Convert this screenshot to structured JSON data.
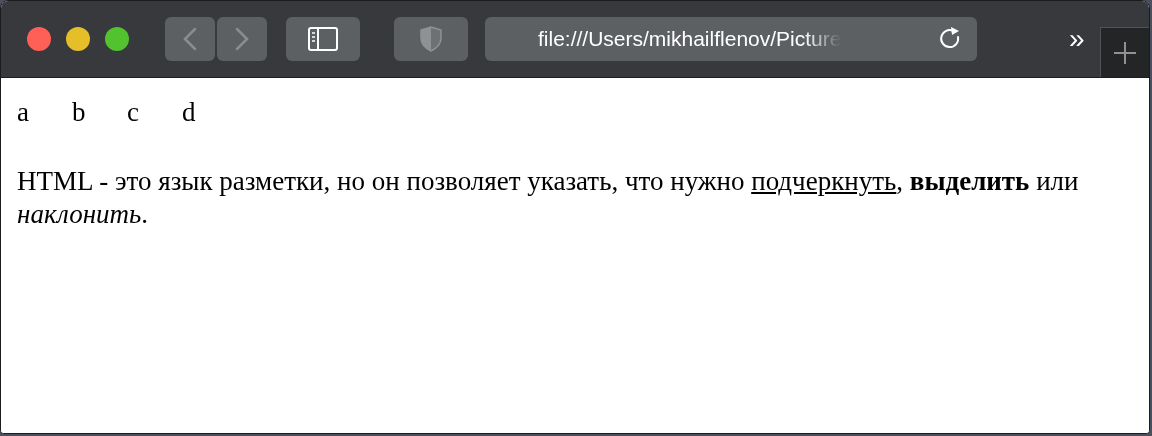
{
  "toolbar": {
    "address": "file:///Users/mikhailflenov/Picture",
    "overflow": "»"
  },
  "letters": [
    "a",
    "b",
    "c",
    "d"
  ],
  "paragraph": [
    {
      "kind": "plain",
      "text": "HTML - это язык разметки, но он позволяет указать, что нужно "
    },
    {
      "kind": "underlined",
      "text": "подчеркнуть"
    },
    {
      "kind": "plain",
      "text": ", "
    },
    {
      "kind": "bold",
      "text": "выделить"
    },
    {
      "kind": "plain",
      "text": " или "
    },
    {
      "kind": "italic",
      "text": "наклонить"
    },
    {
      "kind": "plain",
      "text": "."
    }
  ]
}
